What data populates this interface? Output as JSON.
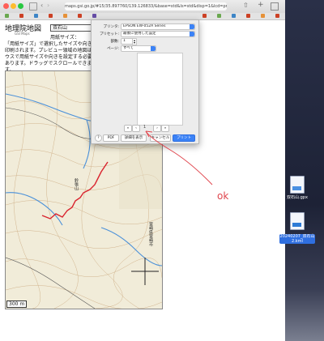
{
  "browser": {
    "url": "maps.gsi.go.jp/#15/35.897760/139.126833/&base=std&ls=std&disp=1&lcd=print",
    "colors": {
      "close": "#ff5f57",
      "min": "#febc2e",
      "max": "#28c840"
    }
  },
  "page": {
    "title": "地理院地図",
    "subtitle": "GSI Maps",
    "map_name": "双石山",
    "paper_size_label": "用紙サイズ：",
    "description": "「用紙サイズ」で選択したサイズや向きで印刷されます。プレビュー領域の地図はマウスで用紙サイズや向きを設定する必要があります。ドラッグでスクロールできます。",
    "map_route_label": "鈴張山",
    "map_right_label": "宮崎県宮崎市",
    "scale_label": "300 m"
  },
  "print_dialog": {
    "printer_label": "プリンタ:",
    "printer_value": "EPSON EW-052A Series",
    "presets_label": "プリセット:",
    "presets_value": "最後に使用した設定",
    "copies_label": "部数:",
    "copies_value": "1",
    "pages_label": "ページ:",
    "pages_value": "すべて",
    "page_count": "1",
    "help": "?",
    "pdf": "PDF",
    "details": "詳細を表示",
    "cancel": "キャンセル",
    "print": "プリント"
  },
  "annotation": {
    "text": "ok",
    "color": "#e0454d"
  },
  "desktop": {
    "files": [
      {
        "name": "双石山.gpx"
      },
      {
        "name": "20240207_双石山\n2.kml"
      }
    ]
  }
}
